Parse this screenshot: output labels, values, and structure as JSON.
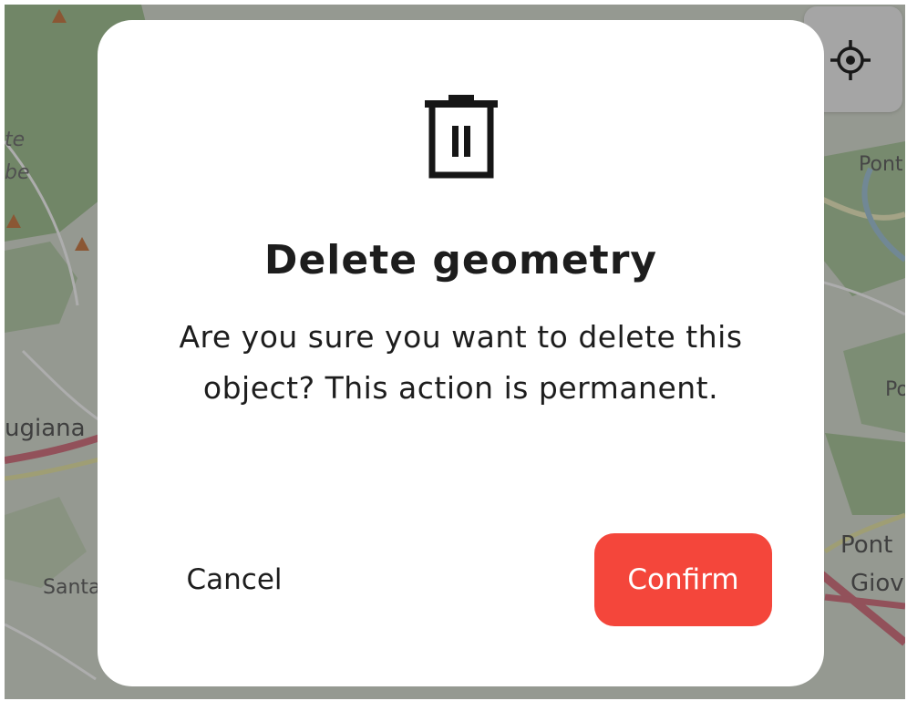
{
  "map": {
    "labels": {
      "left_top_1": "te",
      "left_top_2": "be",
      "left_mid": "ugiana",
      "left_bottom": "Santa",
      "right_top": "Pont",
      "right_mid": "Po",
      "right_bottom_1": "Pont",
      "right_bottom_2": "Giov"
    }
  },
  "locate_button": {
    "icon": "crosshair-gps-icon"
  },
  "dialog": {
    "icon": "trash-icon",
    "title": "Delete geometry",
    "message": "Are you sure you want to delete this object? This action is permanent.",
    "cancel_label": "Cancel",
    "confirm_label": "Confirm",
    "confirm_color": "#f4463b"
  }
}
